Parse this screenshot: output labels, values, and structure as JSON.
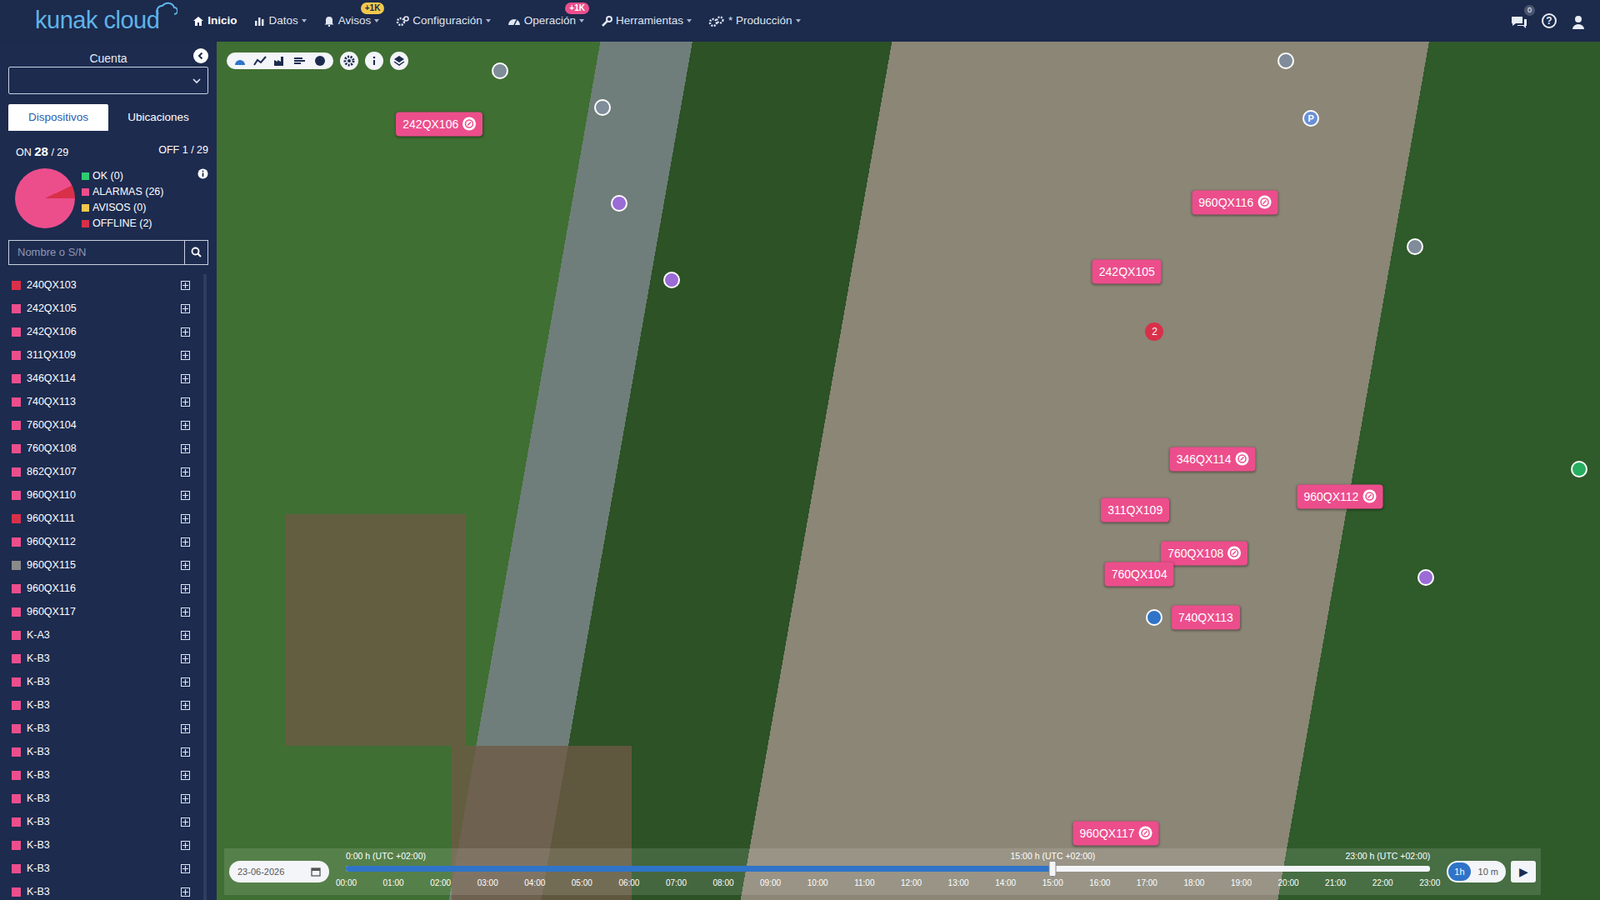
{
  "brand": "kunak cloud",
  "nav": [
    {
      "label": "Inicio",
      "selected": true,
      "dropdown": false
    },
    {
      "label": "Datos",
      "selected": false,
      "dropdown": true
    },
    {
      "label": "Avisos",
      "selected": false,
      "dropdown": true,
      "badge": {
        "text": "+1K",
        "color": "#f2c94c"
      }
    },
    {
      "label": "Configuración",
      "selected": false,
      "dropdown": true
    },
    {
      "label": "Operación",
      "selected": false,
      "dropdown": true,
      "badge": {
        "text": "+1K",
        "color": "#ec4e8c"
      }
    },
    {
      "label": "Herramientas",
      "selected": false,
      "dropdown": true
    },
    {
      "label": "* Producción",
      "selected": false,
      "dropdown": true
    }
  ],
  "header_right": {
    "chat_badge": "0",
    "help": "?"
  },
  "sidebar": {
    "account_label": "Cuenta",
    "tabs": [
      {
        "label": "Dispositivos",
        "selected": true
      },
      {
        "label": "Ubicaciones",
        "selected": false
      }
    ],
    "on_label": "ON",
    "on_value": "28",
    "on_total": "/ 29",
    "off": "OFF 1 / 29",
    "legend": [
      {
        "label": "OK (0)",
        "value": 0,
        "color": "#2ecc71"
      },
      {
        "label": "ALARMAS (26)",
        "value": 26,
        "color": "#ec4e8c"
      },
      {
        "label": "AVISOS (0)",
        "value": 0,
        "color": "#f2c94c"
      },
      {
        "label": "OFFLINE (2)",
        "value": 2,
        "color": "#d9304a"
      }
    ],
    "search": {
      "placeholder": "Nombre o S/N"
    },
    "devices": [
      {
        "name": "240QX103",
        "color": "#d9304a"
      },
      {
        "name": "242QX105",
        "color": "#ec4e8c"
      },
      {
        "name": "242QX106",
        "color": "#ec4e8c"
      },
      {
        "name": "311QX109",
        "color": "#ec4e8c"
      },
      {
        "name": "346QX114",
        "color": "#ec4e8c"
      },
      {
        "name": "740QX113",
        "color": "#ec4e8c"
      },
      {
        "name": "760QX104",
        "color": "#ec4e8c"
      },
      {
        "name": "760QX108",
        "color": "#ec4e8c"
      },
      {
        "name": "862QX107",
        "color": "#ec4e8c"
      },
      {
        "name": "960QX110",
        "color": "#ec4e8c"
      },
      {
        "name": "960QX111",
        "color": "#d9304a"
      },
      {
        "name": "960QX112",
        "color": "#ec4e8c"
      },
      {
        "name": "960QX115",
        "color": "#8a8a8a"
      },
      {
        "name": "960QX116",
        "color": "#ec4e8c"
      },
      {
        "name": "960QX117",
        "color": "#ec4e8c"
      },
      {
        "name": "K-A3",
        "color": "#ec4e8c"
      },
      {
        "name": "K-B3",
        "color": "#ec4e8c"
      },
      {
        "name": "K-B3",
        "color": "#ec4e8c"
      },
      {
        "name": "K-B3",
        "color": "#ec4e8c"
      },
      {
        "name": "K-B3",
        "color": "#ec4e8c"
      },
      {
        "name": "K-B3",
        "color": "#ec4e8c"
      },
      {
        "name": "K-B3",
        "color": "#ec4e8c"
      },
      {
        "name": "K-B3",
        "color": "#ec4e8c"
      },
      {
        "name": "K-B3",
        "color": "#ec4e8c"
      },
      {
        "name": "K-B3",
        "color": "#ec4e8c"
      },
      {
        "name": "K-B3",
        "color": "#ec4e8c"
      },
      {
        "name": "K-B3",
        "color": "#ec4e8c"
      }
    ]
  },
  "map": {
    "pins": [
      {
        "label": "242QX106",
        "kind": "icon"
      },
      {
        "label": "960QX116",
        "kind": "icon"
      },
      {
        "label": "242QX105",
        "kind": "plain"
      },
      {
        "label": "346QX114",
        "kind": "icon"
      },
      {
        "label": "960QX112",
        "kind": "icon"
      },
      {
        "label": "311QX109",
        "kind": "plain"
      },
      {
        "label": "760QX108",
        "kind": "icon"
      },
      {
        "label": "760QX104",
        "kind": "plain"
      },
      {
        "label": "740QX113",
        "kind": "plain"
      },
      {
        "label": "960QX117",
        "kind": "icon"
      }
    ],
    "cluster": "2",
    "markers": [
      {
        "label": "",
        "color": "#7f8c9a"
      },
      {
        "label": "",
        "color": "#7f8c9a"
      },
      {
        "label": "",
        "color": "#9b6bd6"
      },
      {
        "label": "",
        "color": "#9b6bd6"
      },
      {
        "label": "",
        "color": "#7f8c9a"
      },
      {
        "label": "P",
        "color": "#6a8fd8"
      },
      {
        "label": "",
        "color": "#7f8c9a"
      },
      {
        "label": "",
        "color": "#9b6bd6"
      },
      {
        "label": "",
        "color": "#27ae60"
      },
      {
        "label": "",
        "color": "#2f74c8"
      }
    ]
  },
  "timeline": {
    "date": "23-06-2026",
    "start": "0:00 h (UTC +02:00)",
    "current": "15:00 h (UTC +02:00)",
    "end": "23:00 h (UTC +02:00)",
    "level": 0.652,
    "hours": [
      "00:00",
      "01:00",
      "02:00",
      "03:00",
      "04:00",
      "05:00",
      "06:00",
      "07:00",
      "08:00",
      "09:00",
      "10:00",
      "11:00",
      "12:00",
      "13:00",
      "14:00",
      "15:00",
      "16:00",
      "17:00",
      "18:00",
      "19:00",
      "20:00",
      "21:00",
      "22:00",
      "23:00"
    ],
    "steps": [
      {
        "label": "1h",
        "selected": true
      },
      {
        "label": "10 m",
        "selected": false
      }
    ],
    "play": "▶"
  }
}
